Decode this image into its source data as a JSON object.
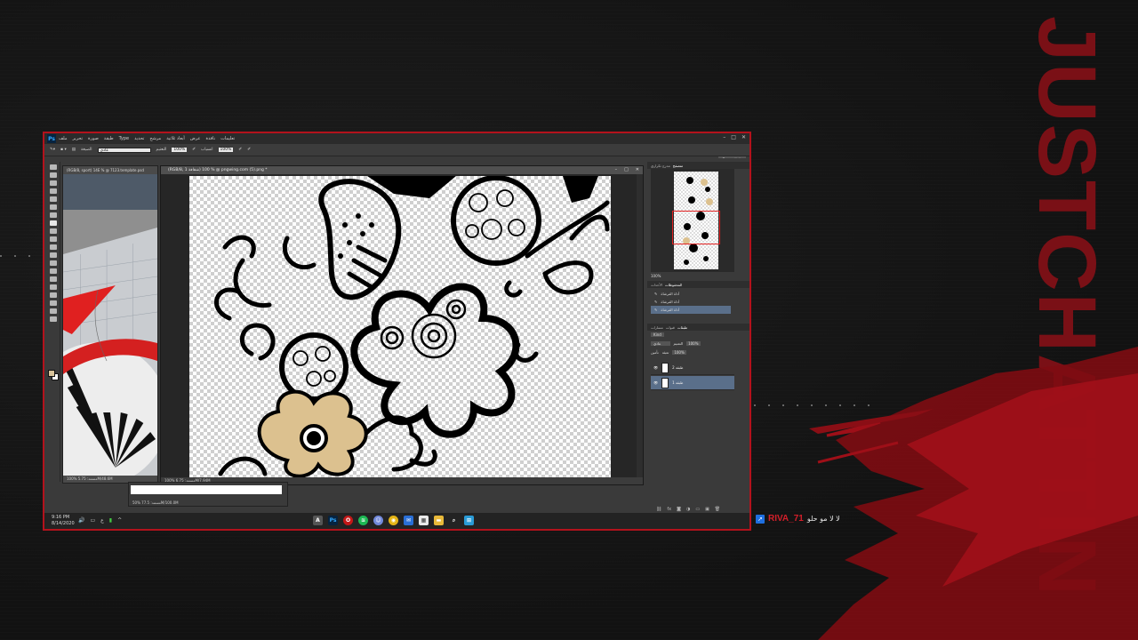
{
  "overlay": {
    "brand_text": "JUSTCHATTIN",
    "streamer_name": "RIVA_71",
    "streamer_message": "لا لا مو حلو",
    "accent_color": "#b3121c"
  },
  "app": {
    "logo": "Ps",
    "menu": [
      "ملف",
      "تحرير",
      "صورة",
      "طبقة",
      "Type",
      "تحديد",
      "مرشح",
      "أبعاد ثلاثية",
      "عرض",
      "نافذة",
      "تعليمات"
    ],
    "window_controls": [
      "–",
      "□",
      "✕"
    ],
    "options": {
      "mode_label": "الصيغة",
      "mode_value": "عادي",
      "opacity_label": "التعتيم",
      "opacity_value": "100%",
      "flow_label": "انسياب",
      "flow_value": "100%"
    },
    "workspace": "Essentials"
  },
  "doc_left": {
    "tab": "(RGB/8, sport) 14E % @ 7123.template.psd",
    "status": "100%   مستند: 5.75M/48.6M"
  },
  "doc_main": {
    "tab": "(RGB/8, 1 شفافة) 100 % @ pngwing.com (5).png *",
    "controls": [
      "–",
      "□",
      "✕"
    ],
    "status": "100%   مستند: 6.75M/7.94M"
  },
  "mini_window": {
    "status": "50%   مستند: 77.5M/100.0M"
  },
  "panels": {
    "navigator_tabs": [
      "مدرج تكراري",
      "متصفح"
    ],
    "navigator_zoom": "100%",
    "history_tabs": [
      "الأحداث",
      "المحفوظات"
    ],
    "history_items": [
      "أداة الفرشاة",
      "أداة الفرشاة",
      "أداة الفرشاة"
    ],
    "layers_tabs": [
      "طبقات",
      "قنوات",
      "مسارات"
    ],
    "blend_mode": "عادي",
    "layer_opacity_label": "التعتيم",
    "layer_opacity_value": "100%",
    "fill_label": "تعبئة",
    "fill_value": "100%",
    "lock_label": "تأمين",
    "kind_label": "Kind",
    "layers": [
      {
        "name": "طبقة 2",
        "selected": false
      },
      {
        "name": "طبقة 1",
        "selected": true
      }
    ]
  },
  "taskbar": {
    "time": "9:16 PM",
    "date": "8/14/2020",
    "apps": [
      "search",
      "photoshop",
      "opera",
      "spotify",
      "discord",
      "chrome",
      "mail",
      "store",
      "explorer",
      "search-window",
      "windows"
    ]
  }
}
